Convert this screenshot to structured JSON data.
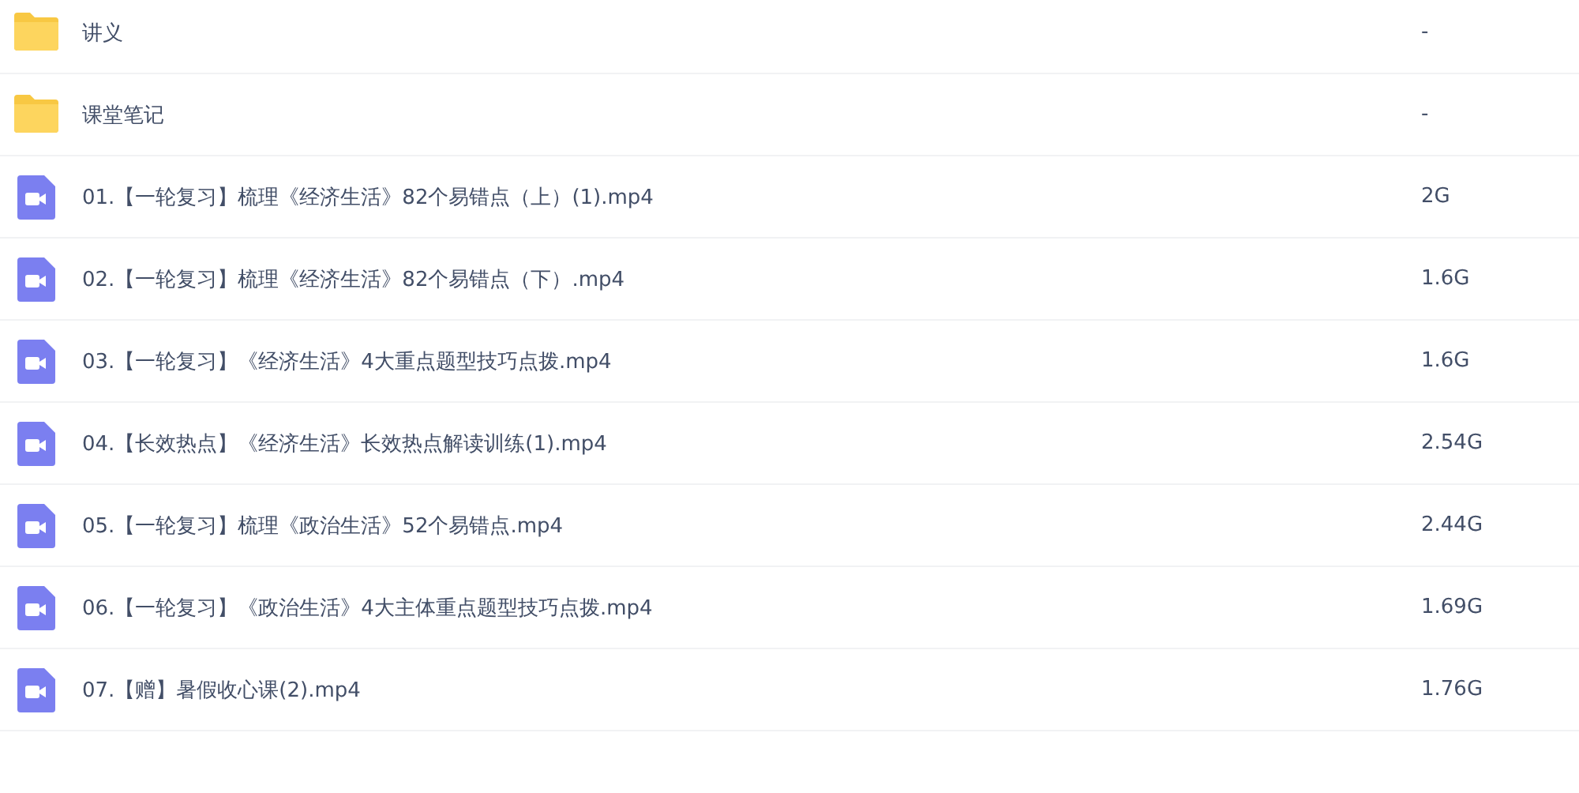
{
  "files": [
    {
      "kind": "folder",
      "name": "讲义",
      "size": "-"
    },
    {
      "kind": "folder",
      "name": "课堂笔记",
      "size": "-"
    },
    {
      "kind": "video",
      "name": "01.【一轮复习】梳理《经济生活》82个易错点（上）(1).mp4",
      "size": "2G"
    },
    {
      "kind": "video",
      "name": "02.【一轮复习】梳理《经济生活》82个易错点（下）.mp4",
      "size": "1.6G"
    },
    {
      "kind": "video",
      "name": "03.【一轮复习】《经济生活》4大重点题型技巧点拨.mp4",
      "size": "1.6G"
    },
    {
      "kind": "video",
      "name": "04.【长效热点】《经济生活》长效热点解读训练(1).mp4",
      "size": "2.54G"
    },
    {
      "kind": "video",
      "name": "05.【一轮复习】梳理《政治生活》52个易错点.mp4",
      "size": "2.44G"
    },
    {
      "kind": "video",
      "name": "06.【一轮复习】《政治生活》4大主体重点题型技巧点拨.mp4",
      "size": "1.69G"
    },
    {
      "kind": "video",
      "name": "07.【赠】暑假收心课(2).mp4",
      "size": "1.76G"
    }
  ]
}
